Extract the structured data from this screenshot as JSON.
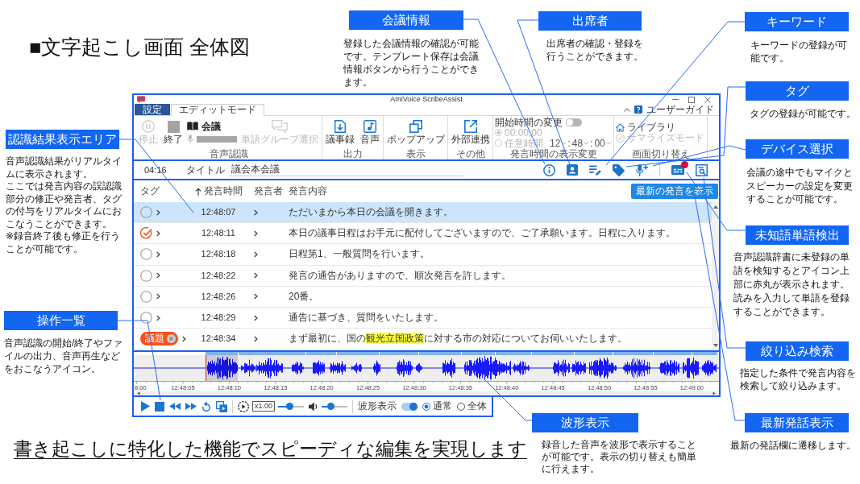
{
  "heading": "■文字起こし画面 全体図",
  "callouts": [
    {
      "title": "会議情報",
      "paragraphs": [
        "登録した会議情報の確認が可能です。テンプレート保存は会議情報ボタンから行うことができます。"
      ]
    },
    {
      "title": "出席者",
      "paragraphs": [
        "出席者の確認・登録を行うことができます。"
      ]
    },
    {
      "title": "キーワード",
      "paragraphs": [
        "キーワードの登録が可能です。"
      ]
    },
    {
      "title": "タグ",
      "paragraphs": [
        "タグの登録が可能です。"
      ]
    },
    {
      "title": "認識結果表示エリア",
      "paragraphs": [
        "音声認識結果がリアルタイムに表示されます。",
        "ここでは発言内容の誤認識部分の修正や発言者、タグの付与をリアルタイムにおこなうことができます。",
        "※録音終了後も修正を行うことが可能です。"
      ]
    },
    {
      "title": "デバイス選択",
      "paragraphs": [
        "会議の途中でもマイクとスピーカーの設定を変更することが可能です。"
      ]
    },
    {
      "title": "未知語単語検出",
      "paragraphs": [
        "音声認識辞書に未登録の単語を検知するとアイコン上部に赤丸が表示されます。読みを入力して単語を登録することができます。"
      ]
    },
    {
      "title": "操作一覧",
      "paragraphs": [
        "音声認識の開始/終了やファイルの出力、音声再生などをおこなうアイコン。"
      ]
    },
    {
      "title": "絞り込み検索",
      "paragraphs": [
        "指定した条件で発言内容を検索して絞り込みます。"
      ]
    },
    {
      "title": "波形表示",
      "paragraphs": [
        "録音した音声を波形で表示することが可能です。表示の切り替えも簡単に行えます。"
      ]
    },
    {
      "title": "最新発話表示",
      "paragraphs": [
        "最新の発話欄に遷移します。"
      ]
    }
  ],
  "app": {
    "window": {
      "title": "AmiVoice ScribeAssist"
    },
    "tabs": [
      {
        "label": "設定",
        "kind": "menu",
        "selected": false
      },
      {
        "label": "エディットモード",
        "kind": "tab",
        "selected": true
      }
    ],
    "help_link": "ユーザーガイド",
    "ribbon_groups": [
      {
        "label": "音声認識",
        "items": [
          {
            "kind": "large",
            "label": "停止",
            "disabled": true
          },
          {
            "kind": "large",
            "label": "終了",
            "disabled": false
          },
          {
            "kind": "source",
            "label": "会議"
          },
          {
            "kind": "large",
            "label": "単語グループ選択",
            "disabled": true
          }
        ]
      },
      {
        "label": "出力",
        "items": [
          {
            "kind": "large",
            "label": "議事録",
            "disabled": false
          },
          {
            "kind": "large",
            "label": "音声",
            "disabled": false
          }
        ]
      },
      {
        "label": "表示",
        "items": [
          {
            "kind": "large",
            "label": "ポップアップ",
            "disabled": false
          }
        ]
      },
      {
        "label": "その他",
        "items": [
          {
            "kind": "large",
            "label": "外部連携",
            "disabled": false
          }
        ]
      },
      {
        "label": "発言時間の表示変更",
        "items": [
          {
            "kind": "toggle",
            "label": "開始時間の変更",
            "on": false
          },
          {
            "kind": "radio",
            "label": "00:00:00",
            "selected": true,
            "disabled": true
          },
          {
            "kind": "radio",
            "label": "任意時間",
            "selected": false,
            "disabled": true,
            "time": [
              {
                "kind": "field",
                "text": "12"
              },
              {
                "kind": "separator",
                "text": ":"
              },
              {
                "kind": "field",
                "text": "48"
              },
              {
                "kind": "separator",
                "text": ":"
              },
              {
                "kind": "field",
                "text": "00"
              }
            ]
          }
        ]
      },
      {
        "label": "画面切り替え",
        "items": [
          {
            "kind": "small",
            "label": "ライブラリ",
            "disabled": false
          },
          {
            "kind": "small",
            "label": "サマライズモード",
            "disabled": true
          }
        ]
      }
    ],
    "toolbar": {
      "elapsed": "04:16",
      "title_label": "タイトル",
      "title_value": "議会本会議",
      "unknown_word_alert": true
    },
    "table": {
      "columns": [
        {
          "label": "タグ",
          "sorted": false
        },
        {
          "label": "発言時間",
          "sorted": true
        },
        {
          "label": "発言者",
          "sorted": false
        },
        {
          "label": "発言内容",
          "sorted": false
        }
      ],
      "latest_button": "最新の発言を表示",
      "rows": [
        {
          "selected": true,
          "tag": {
            "kind": "circle",
            "checked": false
          },
          "time": "12:48:07",
          "content": [
            {
              "text": "ただいまから本日の会議を開きます。",
              "highlighted": false
            }
          ]
        },
        {
          "selected": false,
          "tag": {
            "kind": "circle",
            "checked": true
          },
          "time": "12:48:11",
          "content": [
            {
              "text": "本日の議事日程はお手元に配付してございますので、ご了承願います。日程に入ります。",
              "highlighted": false
            }
          ]
        },
        {
          "selected": false,
          "tag": {
            "kind": "circle",
            "checked": false
          },
          "time": "12:48:18",
          "content": [
            {
              "text": "日程第1、一般質問を行います。",
              "highlighted": false
            }
          ]
        },
        {
          "selected": false,
          "tag": {
            "kind": "circle",
            "checked": false
          },
          "time": "12:48:22",
          "content": [
            {
              "text": "発言の通告がありますので、順次発言を許します。",
              "highlighted": false
            }
          ]
        },
        {
          "selected": false,
          "tag": {
            "kind": "circle",
            "checked": false
          },
          "time": "12:48:26",
          "content": [
            {
              "text": "20番。",
              "highlighted": false
            }
          ]
        },
        {
          "selected": false,
          "tag": {
            "kind": "circle",
            "checked": false
          },
          "time": "12:48:29",
          "content": [
            {
              "text": "通告に基づき、質問をいたします。",
              "highlighted": false
            }
          ]
        },
        {
          "selected": false,
          "tag": {
            "kind": "chip",
            "label": "議題"
          },
          "time": "12:48:34",
          "content": [
            {
              "text": "まず最初に、国の",
              "highlighted": false
            },
            {
              "text": "観光立国政策",
              "highlighted": true
            },
            {
              "text": "に対する市の対応についてお伺いいたします。",
              "highlighted": false
            }
          ]
        }
      ]
    },
    "waveform": {
      "time_labels": [
        "8:00",
        "12:48:05",
        "12:48:10",
        "12:48:15",
        "12:48:20",
        "12:48:25",
        "12:48:30",
        "12:48:35",
        "12:48:40",
        "12:48:45",
        "12:48:50",
        "12:48:55",
        "12:49:00"
      ]
    },
    "player": {
      "speed": "x1.00",
      "speed_slider": {
        "level": 0.45
      },
      "volume_slider": {
        "level": 0.3
      },
      "waveform_toggle": {
        "label": "波形表示",
        "on": true
      },
      "view_modes": [
        {
          "label": "通常",
          "selected": true
        },
        {
          "label": "全体",
          "selected": false
        }
      ]
    }
  },
  "tagline": "書き起こしに特化した機能でスピーディな編集を実現します"
}
